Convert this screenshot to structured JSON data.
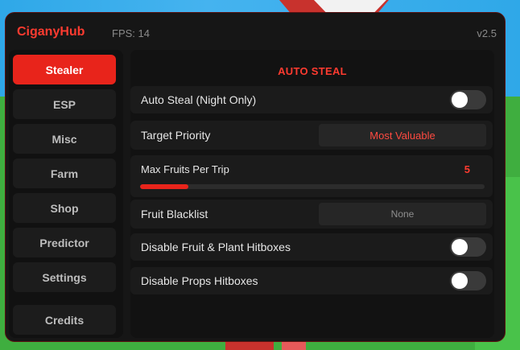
{
  "app": {
    "title": "CiganyHub",
    "fps": "FPS: 14",
    "version": "v2.5"
  },
  "colors": {
    "accent": "#e8241b",
    "accent_text": "#ff3b30",
    "window_bg": "#161616",
    "row_bg": "#1b1b1b"
  },
  "sidebar": {
    "items": [
      {
        "label": "Stealer",
        "active": true
      },
      {
        "label": "ESP",
        "active": false
      },
      {
        "label": "Misc",
        "active": false
      },
      {
        "label": "Farm",
        "active": false
      },
      {
        "label": "Shop",
        "active": false
      },
      {
        "label": "Predictor",
        "active": false
      },
      {
        "label": "Settings",
        "active": false
      },
      {
        "label": "Credits",
        "active": false
      }
    ]
  },
  "main": {
    "section_title": "AUTO STEAL",
    "auto_steal": {
      "label": "Auto Steal (Night Only)",
      "enabled": false
    },
    "target_priority": {
      "label": "Target Priority",
      "value": "Most Valuable"
    },
    "max_fruits": {
      "label": "Max Fruits Per Trip",
      "value": "5",
      "fill_percent": 14
    },
    "fruit_blacklist": {
      "label": "Fruit Blacklist",
      "value": "None"
    },
    "disable_fruit_hitboxes": {
      "label": "Disable Fruit & Plant Hitboxes",
      "enabled": false
    },
    "disable_props_hitboxes": {
      "label": "Disable Props Hitboxes",
      "enabled": false
    }
  }
}
